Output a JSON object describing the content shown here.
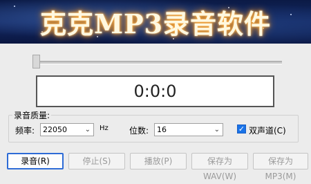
{
  "banner": {
    "title": "克克MP3录音软件"
  },
  "position_fraction": 0.0,
  "time_display": "0:0:0",
  "quality": {
    "group_label": "录音质量:",
    "sample_rate_label": "频率:",
    "sample_rate_value": "22050",
    "sample_rate_unit": "Hz",
    "bits_label": "位数:",
    "bits_value": "16",
    "stereo_label": "双声道(C)",
    "stereo_checked": true
  },
  "buttons": {
    "record": "录音(R)",
    "stop": "停止(S)",
    "play": "播放(P)",
    "save_wav": "保存为WAV(W)",
    "save_mp3": "保存为MP3(M)"
  }
}
